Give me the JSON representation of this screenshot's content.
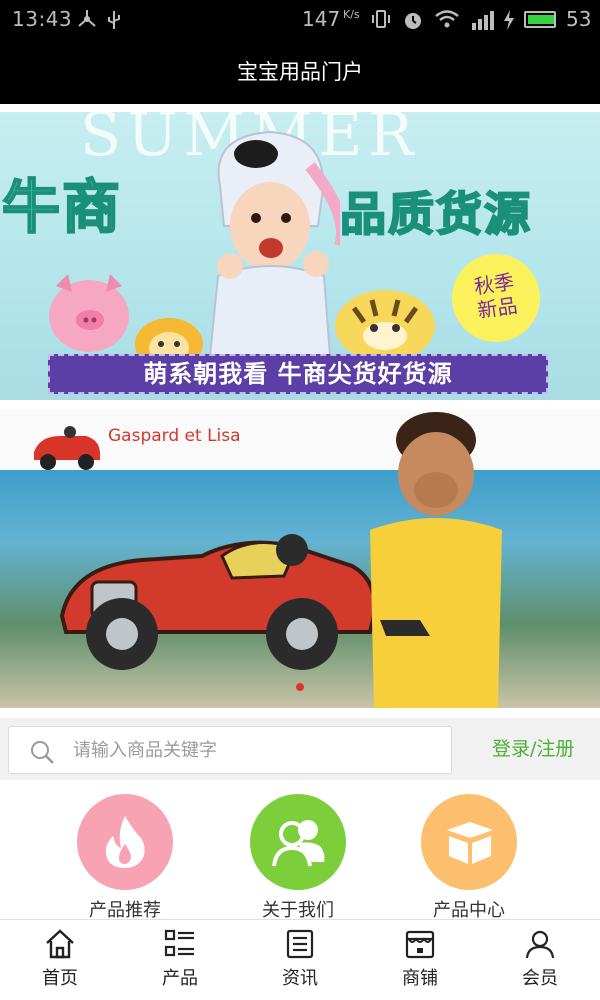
{
  "status_bar": {
    "time": "13:43",
    "net_speed": "147",
    "net_unit": "K/s",
    "battery_level": "53"
  },
  "header": {
    "title": "宝宝用品门户"
  },
  "banner1": {
    "bg_text": "SUMMER",
    "headline_left": "牛商",
    "headline_right": "品质货源",
    "badge_line1": "秋季",
    "badge_line2": "新品",
    "ribbon": "萌系朝我看  牛商尖货好货源"
  },
  "banner2": {
    "brand": "Gaspard et Lisa"
  },
  "search": {
    "placeholder": "请输入商品关键字",
    "login_label": "登录/注册"
  },
  "categories": [
    {
      "label": "产品推荐",
      "icon": "fire-icon",
      "color": "#f7a3b3"
    },
    {
      "label": "关于我们",
      "icon": "users-icon",
      "color": "#7ccf3a"
    },
    {
      "label": "产品中心",
      "icon": "box-icon",
      "color": "#fbbf6e"
    }
  ],
  "bottom_nav": [
    {
      "label": "首页",
      "icon": "home-icon"
    },
    {
      "label": "产品",
      "icon": "list-icon"
    },
    {
      "label": "资讯",
      "icon": "news-icon"
    },
    {
      "label": "商铺",
      "icon": "shop-icon"
    },
    {
      "label": "会员",
      "icon": "user-icon"
    }
  ],
  "colors": {
    "accent_green": "#4caf36",
    "header_bg": "#000000"
  }
}
